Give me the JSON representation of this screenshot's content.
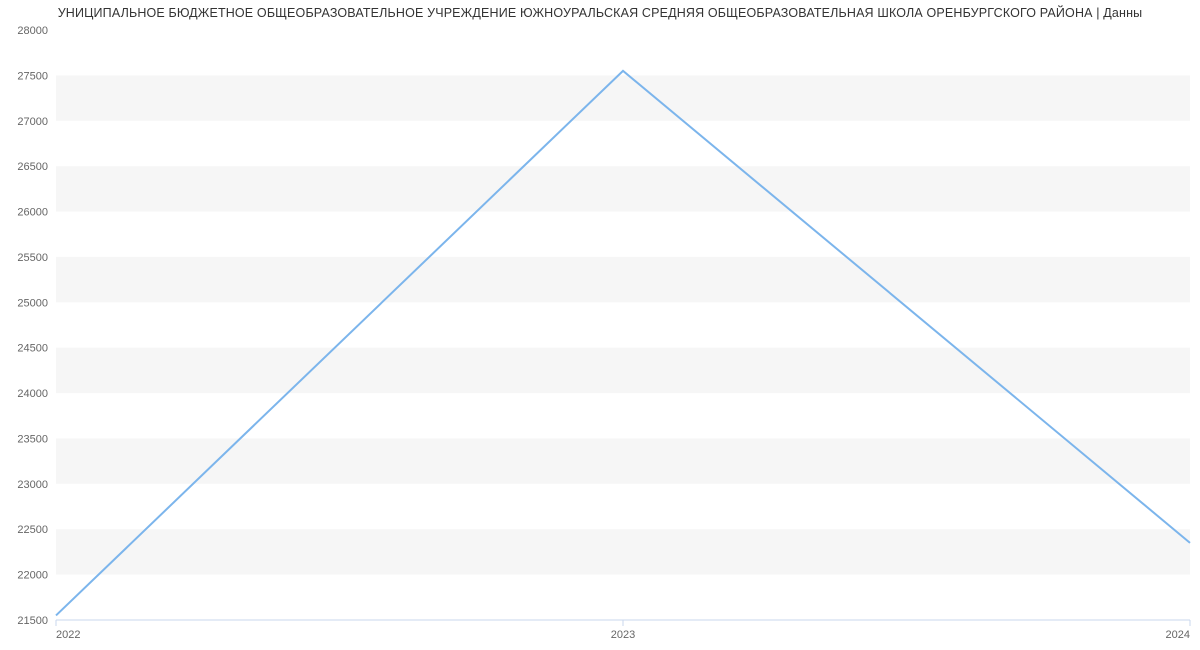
{
  "title": "УНИЦИПАЛЬНОЕ БЮДЖЕТНОЕ ОБЩЕОБРАЗОВАТЕЛЬНОЕ УЧРЕЖДЕНИЕ ЮЖНОУРАЛЬСКАЯ СРЕДНЯЯ ОБЩЕОБРАЗОВАТЕЛЬНАЯ ШКОЛА ОРЕНБУРГСКОГО РАЙОНА | Данны",
  "chart_data": {
    "type": "line",
    "categories": [
      "2022",
      "2023",
      "2024"
    ],
    "values": [
      21550,
      27550,
      22350
    ],
    "title": "УНИЦИПАЛЬНОЕ БЮДЖЕТНОЕ ОБЩЕОБРАЗОВАТЕЛЬНОЕ УЧРЕЖДЕНИЕ ЮЖНОУРАЛЬСКАЯ СРЕДНЯЯ ОБЩЕОБРАЗОВАТЕЛЬНАЯ ШКОЛА ОРЕНБУРГСКОГО РАЙОНА | Данны",
    "xlabel": "",
    "ylabel": "",
    "ylim": [
      21500,
      28000
    ],
    "yticks": [
      21500,
      22000,
      22500,
      23000,
      23500,
      24000,
      24500,
      25000,
      25500,
      26000,
      26500,
      27000,
      27500,
      28000
    ],
    "colors": {
      "series": "#7cb5ec"
    }
  }
}
